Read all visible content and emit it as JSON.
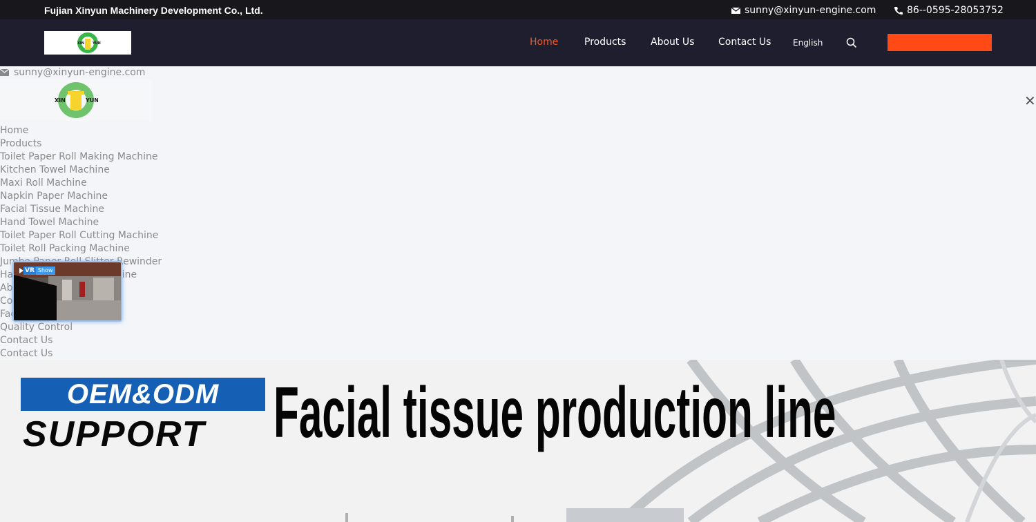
{
  "topbar": {
    "company": "Fujian Xinyun Machinery Development Co., Ltd.",
    "email": "sunny@xinyun-engine.com",
    "phone": "86--0595-28053752"
  },
  "logo": {
    "text_left": "XIN",
    "text_right": "YUN"
  },
  "nav": {
    "items": [
      "Home",
      "Products",
      "About Us",
      "Contact Us"
    ],
    "language": "English",
    "accent": "#f05a22",
    "cta_color": "#ff4a16"
  },
  "mobile_menu": {
    "email": "sunny@xinyun-engine.com",
    "items": [
      "Home",
      "Products",
      "Toilet Paper Roll Making Machine",
      "Kitchen Towel Machine",
      "Maxi Roll Machine",
      "Napkin Paper Machine",
      "Facial Tissue Machine",
      "Hand Towel Machine",
      "Toilet Paper Roll Cutting Machine",
      "Toilet Roll Packing Machine",
      "Jumbo Paper Roll Slitter Rewinder",
      "Hand Towel Folding Machine",
      "About Us",
      "Company Profile",
      "Factory Tour",
      "Quality Control",
      "Contact Us",
      "Contact Us"
    ],
    "close_icon": "close-icon"
  },
  "vr_widget": {
    "vr_label": "VR",
    "show_label": "Show"
  },
  "banner": {
    "oem": "OEM&ODM",
    "support": "SUPPORT",
    "headline": "Facial tissue production line",
    "brand_blue": "#1560b4"
  }
}
